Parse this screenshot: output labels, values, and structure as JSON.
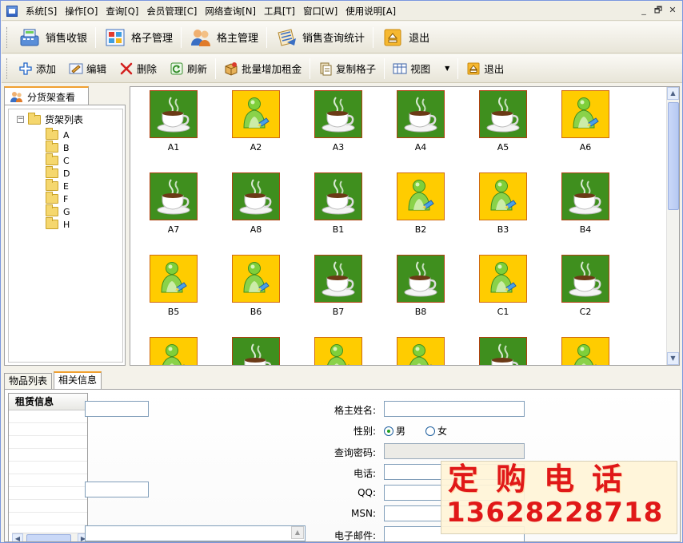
{
  "menubar": {
    "items": [
      "系统[S]",
      "操作[O]",
      "查询[Q]",
      "会员管理[C]",
      "网络查询[N]",
      "工具[T]",
      "窗口[W]",
      "使用说明[A]"
    ],
    "window_controls": [
      "_",
      "🗗",
      "✕"
    ]
  },
  "toolbar1": {
    "items": [
      {
        "label": "销售收银",
        "icon": "cash-register-icon"
      },
      {
        "label": "格子管理",
        "icon": "grid-icon"
      },
      {
        "label": "格主管理",
        "icon": "users-icon"
      },
      {
        "label": "销售查询统计",
        "icon": "report-icon"
      },
      {
        "label": "退出",
        "icon": "exit-icon"
      }
    ]
  },
  "toolbar2": {
    "items": [
      {
        "label": "添加",
        "icon": "plus-icon"
      },
      {
        "label": "编辑",
        "icon": "edit-icon"
      },
      {
        "label": "删除",
        "icon": "delete-icon"
      },
      {
        "label": "刷新",
        "icon": "refresh-icon"
      },
      {
        "label": "批量增加租金",
        "icon": "box-icon"
      },
      {
        "label": "复制格子",
        "icon": "copy-icon"
      },
      {
        "label": "视图",
        "icon": "view-icon"
      },
      {
        "label": "退出",
        "icon": "exit-icon"
      }
    ]
  },
  "left_panel": {
    "tab_label": "分货架查看",
    "tree_root": "货架列表",
    "tree_children": [
      "A",
      "B",
      "C",
      "D",
      "E",
      "F",
      "G",
      "H"
    ]
  },
  "grid": {
    "cells": [
      {
        "label": "A1",
        "status": "occupied"
      },
      {
        "label": "A2",
        "status": "vacant"
      },
      {
        "label": "A3",
        "status": "occupied"
      },
      {
        "label": "A4",
        "status": "occupied"
      },
      {
        "label": "A5",
        "status": "occupied"
      },
      {
        "label": "A6",
        "status": "vacant"
      },
      {
        "label": "A7",
        "status": "occupied"
      },
      {
        "label": "A8",
        "status": "occupied"
      },
      {
        "label": "B1",
        "status": "occupied"
      },
      {
        "label": "B2",
        "status": "vacant"
      },
      {
        "label": "B3",
        "status": "vacant"
      },
      {
        "label": "B4",
        "status": "occupied"
      },
      {
        "label": "B5",
        "status": "vacant"
      },
      {
        "label": "B6",
        "status": "vacant"
      },
      {
        "label": "B7",
        "status": "occupied"
      },
      {
        "label": "B8",
        "status": "occupied"
      },
      {
        "label": "C1",
        "status": "vacant"
      },
      {
        "label": "C2",
        "status": "occupied"
      },
      {
        "label": "",
        "status": "vacant"
      },
      {
        "label": "",
        "status": "occupied"
      },
      {
        "label": "",
        "status": "vacant"
      },
      {
        "label": "",
        "status": "vacant"
      },
      {
        "label": "",
        "status": "occupied"
      },
      {
        "label": "",
        "status": "vacant"
      }
    ],
    "colors": {
      "occupied": "#3f8f1e",
      "vacant": "#ffcc00"
    }
  },
  "bottom": {
    "tabs": [
      "物品列表",
      "相关信息"
    ],
    "active_tab": 1,
    "rent_header": "租赁信息",
    "fields": {
      "owner_name_label": "格主姓名:",
      "gender_label": "性别:",
      "gender_male": "男",
      "gender_female": "女",
      "password_label": "查询密码:",
      "phone_label": "电话:",
      "qq_label": "QQ:",
      "msn_label": "MSN:",
      "email_label": "电子邮件:"
    }
  },
  "ad": {
    "title": "定购电话",
    "phone": "13628228718"
  }
}
